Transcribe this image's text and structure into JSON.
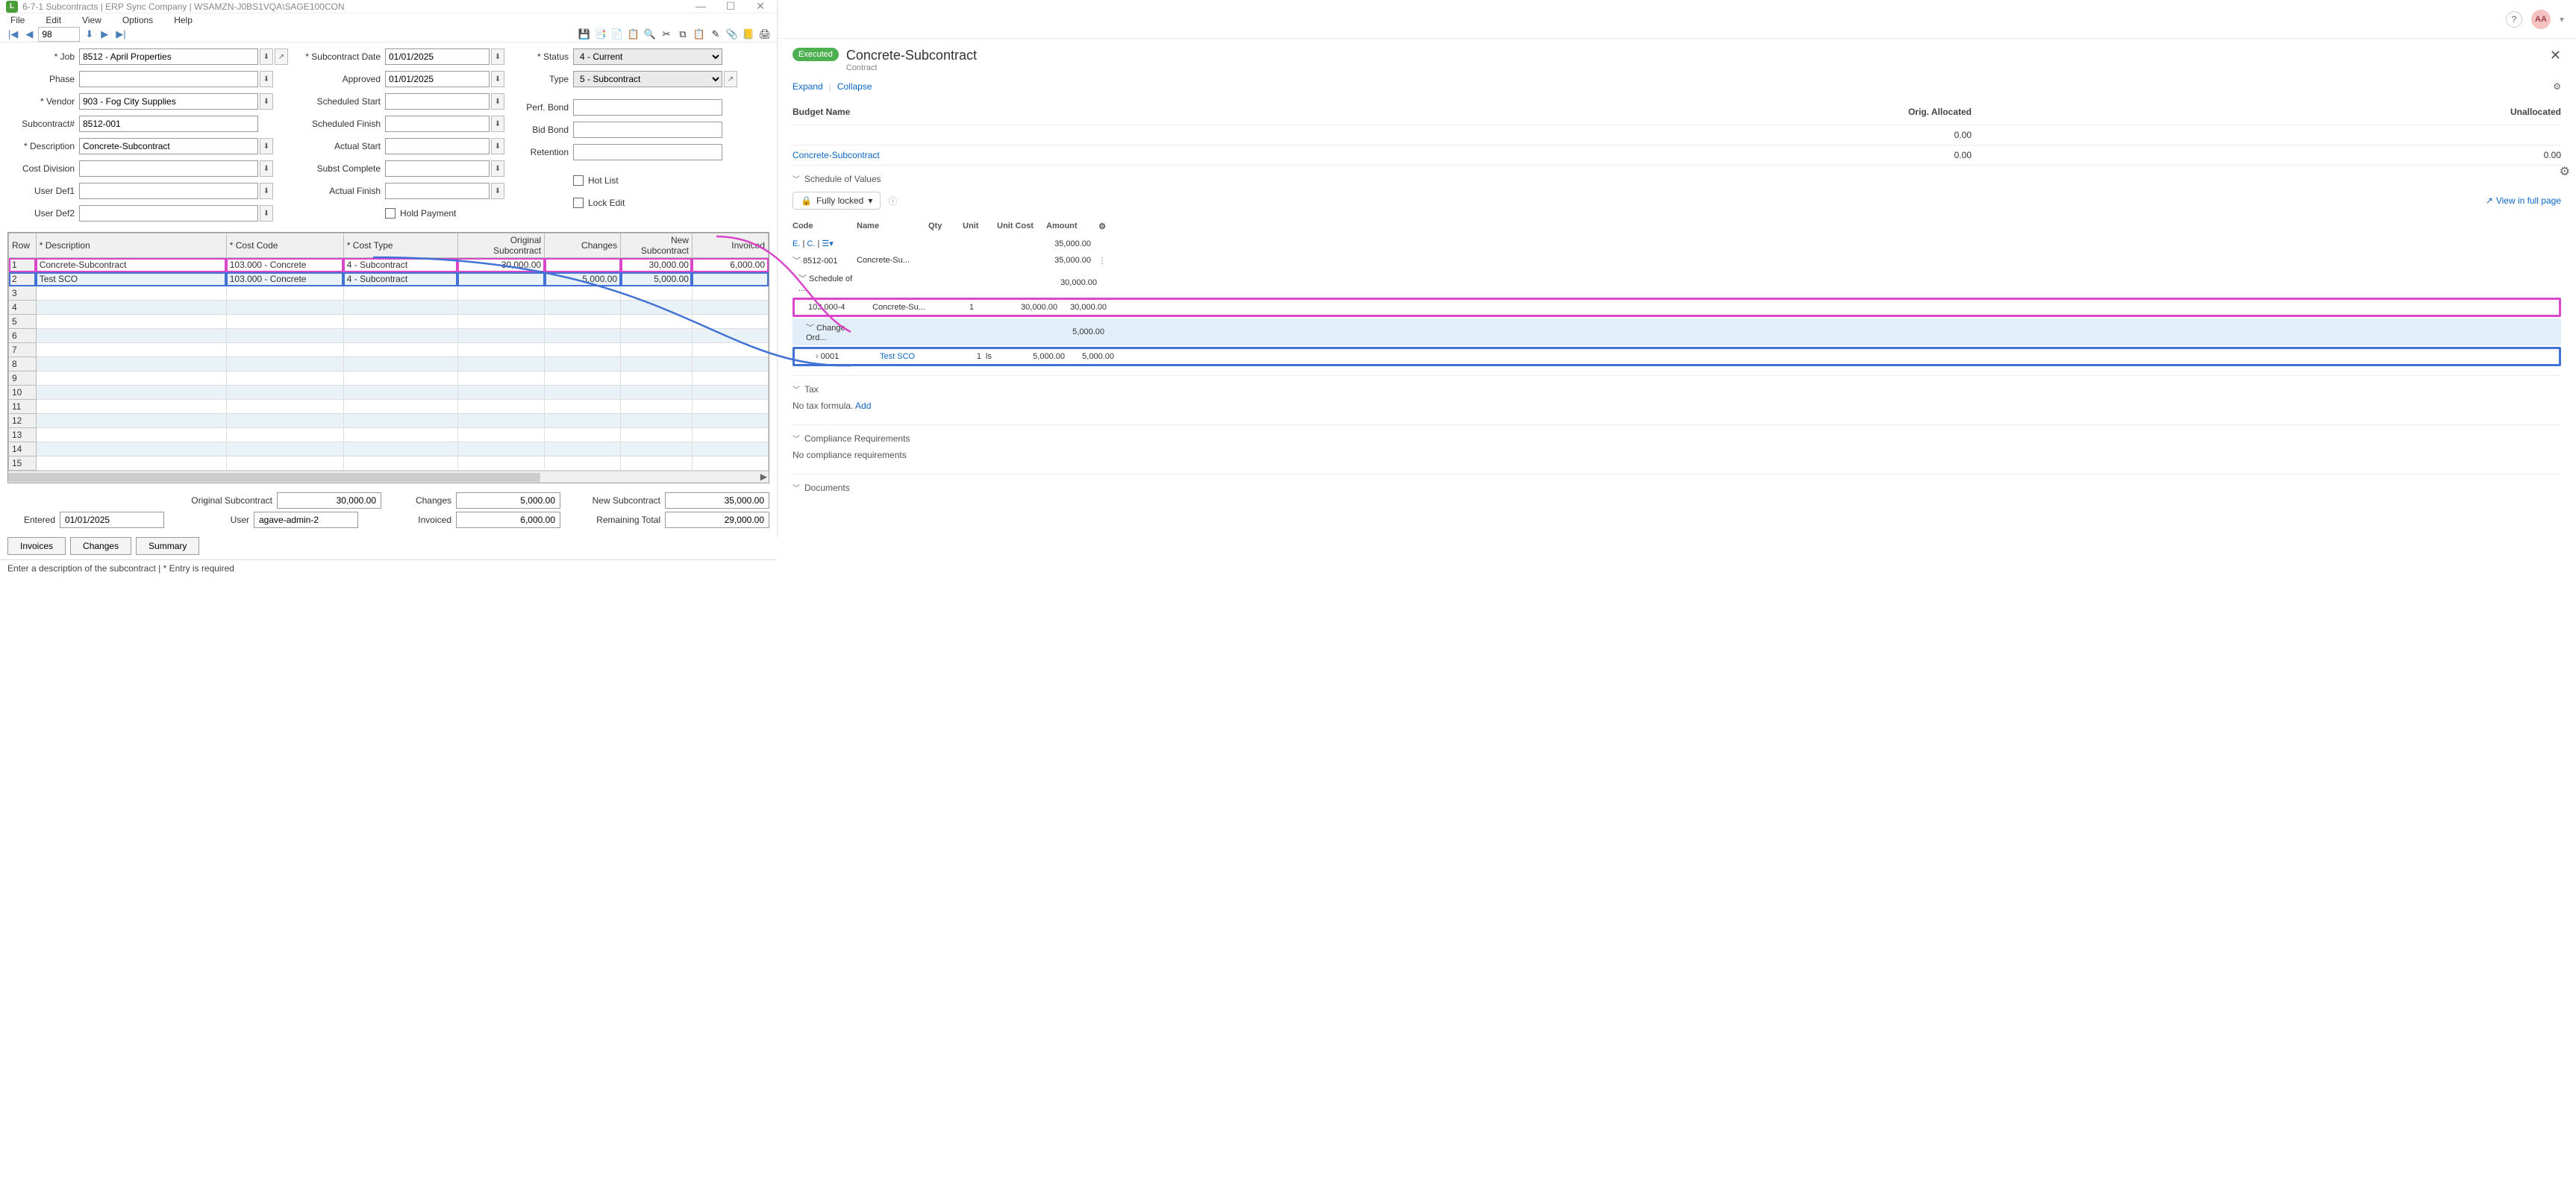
{
  "titlebar": {
    "icon_letter": "L",
    "text": "6-7-1 Subcontracts  |  ERP Sync Company  |  WSAMZN-J0BS1VQA\\SAGE100CON"
  },
  "menus": [
    "File",
    "Edit",
    "View",
    "Options",
    "Help"
  ],
  "nav": {
    "record": "98"
  },
  "form": {
    "job_label": "* Job",
    "job": "8512 - April Properties",
    "phase_label": "Phase",
    "phase": "",
    "vendor_label": "* Vendor",
    "vendor": "903 - Fog City Supplies",
    "subcontractno_label": "Subcontract#",
    "subcontractno": "8512-001",
    "description_label": "* Description",
    "description": "Concrete-Subcontract",
    "costdivision_label": "Cost Division",
    "costdivision": "",
    "userdef1_label": "User Def1",
    "userdef1": "",
    "userdef2_label": "User Def2",
    "userdef2": "",
    "subdate_label": "* Subcontract Date",
    "subdate": "01/01/2025",
    "approved_label": "Approved",
    "approved": "01/01/2025",
    "schedstart_label": "Scheduled Start",
    "schedstart": "",
    "schedfinish_label": "Scheduled Finish",
    "schedfinish": "",
    "actualstart_label": "Actual Start",
    "actualstart": "",
    "substcomplete_label": "Subst Complete",
    "substcomplete": "",
    "actualfinish_label": "Actual Finish",
    "actualfinish": "",
    "status_label": "* Status",
    "status": "4 - Current",
    "type_label": "Type",
    "type": "5 - Subcontract",
    "perfbond_label": "Perf. Bond",
    "perfbond": "",
    "bidbond_label": "Bid Bond",
    "bidbond": "",
    "retention_label": "Retention",
    "retention": "",
    "holdpayment_label": "Hold Payment",
    "hotlist_label": "Hot List",
    "lockedit_label": "Lock Edit"
  },
  "grid": {
    "headers": {
      "row": "Row",
      "description": "* Description",
      "costcode": "* Cost Code",
      "costtype": "* Cost Type",
      "original": "Original Subcontract",
      "changes": "Changes",
      "newsub": "New Subcontract",
      "invoiced": "Invoiced"
    },
    "rows": [
      {
        "n": "1",
        "desc": "Concrete-Subcontract",
        "code": "103.000 - Concrete",
        "type": "4 - Subcontract",
        "orig": "30,000.00",
        "chg": "",
        "newsub": "30,000.00",
        "inv": "6,000.00"
      },
      {
        "n": "2",
        "desc": "Test SCO",
        "code": "103.000 - Concrete",
        "type": "4 - Subcontract",
        "orig": "",
        "chg": "5,000.00",
        "newsub": "5,000.00",
        "inv": ""
      },
      {
        "n": "3"
      },
      {
        "n": "4"
      },
      {
        "n": "5"
      },
      {
        "n": "6"
      },
      {
        "n": "7"
      },
      {
        "n": "8"
      },
      {
        "n": "9"
      },
      {
        "n": "10"
      },
      {
        "n": "11"
      },
      {
        "n": "12"
      },
      {
        "n": "13"
      },
      {
        "n": "14"
      },
      {
        "n": "15"
      }
    ]
  },
  "totals": {
    "orig_label": "Original Subcontract",
    "orig": "30,000.00",
    "changes_label": "Changes",
    "changes": "5,000.00",
    "newsub_label": "New Subcontract",
    "newsub": "35,000.00",
    "entered_label": "Entered",
    "entered": "01/01/2025",
    "user_label": "User",
    "user": "agave-admin-2",
    "invoiced_label": "Invoiced",
    "invoiced": "6,000.00",
    "remaining_label": "Remaining Total",
    "remaining": "29,000.00"
  },
  "buttons": {
    "invoices": "Invoices",
    "changes": "Changes",
    "summary": "Summary"
  },
  "statusbar": "Enter a description of the subcontract   |   * Entry is required",
  "right": {
    "avatar": "AA",
    "badge": "Executed",
    "title": "Concrete-Subcontract",
    "subtitle": "Contract",
    "expand": "Expand",
    "collapse": "Collapse",
    "budget_headers": {
      "name": "Budget Name",
      "orig": "Orig. Allocated",
      "unalloc": "Unallocated"
    },
    "budget_empty_orig": "0.00",
    "budget_row": {
      "name": "Concrete-Subcontract",
      "orig": "0.00",
      "unalloc": "0.00"
    },
    "sov_title": "Schedule of Values",
    "lock_label": "Fully locked",
    "full_page": "View in full page",
    "sov_headers": {
      "code": "Code",
      "name": "Name",
      "qty": "Qty",
      "unit": "Unit",
      "ucost": "Unit Cost",
      "amount": "Amount"
    },
    "sov_tabs_e": "E.",
    "sov_tabs_c": "C.",
    "sov_total_amount": "35,000.00",
    "sov": [
      {
        "code": "8512-001",
        "name": "Concrete-Su...",
        "amount": "35,000.00",
        "menu": "⋮"
      },
      {
        "code": "Schedule of ...",
        "amount": "30,000.00"
      },
      {
        "code": "103.000-4",
        "name": "Concrete-Su...",
        "qty": "1",
        "unit": "",
        "ucost": "30,000.00",
        "amount": "30,000.00",
        "hl": "pink"
      },
      {
        "code": "Change Ord...",
        "amount": "5,000.00",
        "band": true
      },
      {
        "code": "0001",
        "name": "Test SCO",
        "qty": "1",
        "unit": "ls",
        "ucost": "5,000.00",
        "amount": "5,000.00",
        "hl": "blue",
        "linkname": true
      }
    ],
    "tax_title": "Tax",
    "tax_text": "No tax formula. ",
    "tax_add": "Add",
    "compliance_title": "Compliance Requirements",
    "compliance_text": "No compliance requirements",
    "documents_title": "Documents"
  }
}
